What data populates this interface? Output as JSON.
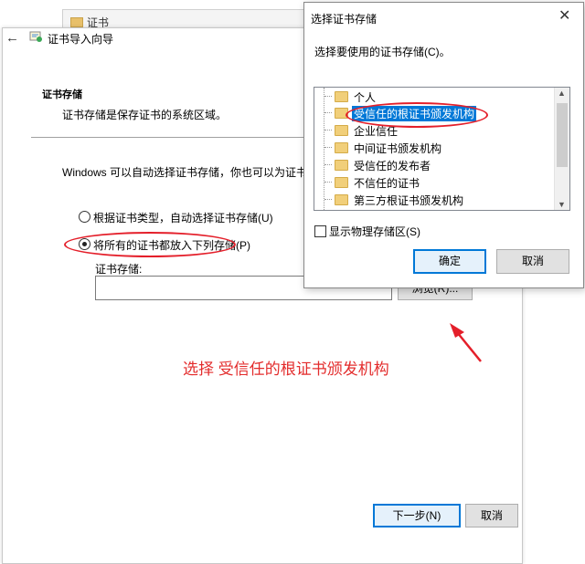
{
  "background_window": {
    "title": "证书"
  },
  "wizard": {
    "title": "证书导入向导",
    "section_title": "证书存储",
    "section_desc": "证书存储是保存证书的系统区域。",
    "intro": "Windows 可以自动选择证书存储，你也可以为证书指",
    "radio_auto": "根据证书类型，自动选择证书存储(U)",
    "radio_manual": "将所有的证书都放入下列存储(P)",
    "store_label": "证书存储:",
    "store_value": "",
    "browse_label": "浏览(R)...",
    "next_label": "下一步(N)",
    "cancel_label": "取消"
  },
  "annotation": "选择 受信任的根证书颁发机构",
  "dialog": {
    "title": "选择证书存储",
    "close": "✕",
    "prompt": "选择要使用的证书存储(C)。",
    "stores": [
      {
        "label": "个人",
        "selected": false
      },
      {
        "label": "受信任的根证书颁发机构",
        "selected": true
      },
      {
        "label": "企业信任",
        "selected": false
      },
      {
        "label": "中间证书颁发机构",
        "selected": false
      },
      {
        "label": "受信任的发布者",
        "selected": false
      },
      {
        "label": "不信任的证书",
        "selected": false
      },
      {
        "label": "第三方根证书颁发机构",
        "selected": false
      }
    ],
    "show_physical": "显示物理存储区(S)",
    "ok_label": "确定",
    "cancel_label": "取消"
  },
  "colors": {
    "accent": "#0078d7",
    "annotation_red": "#e32c2c"
  }
}
